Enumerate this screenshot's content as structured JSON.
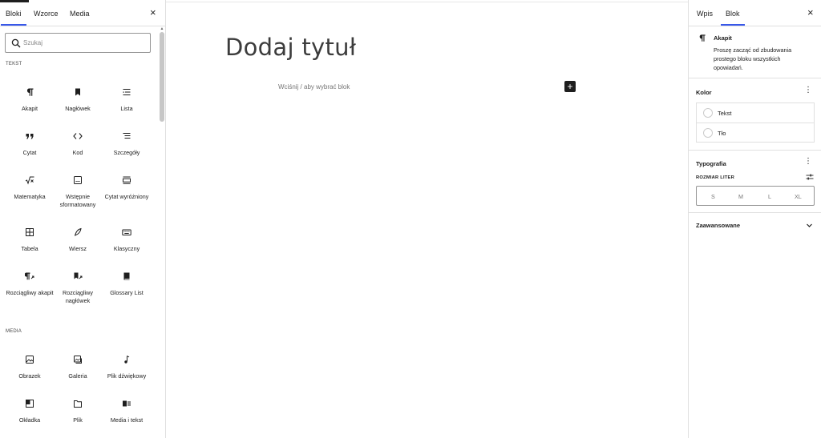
{
  "inserter": {
    "tabs": [
      {
        "label": "Bloki"
      },
      {
        "label": "Wzorce"
      },
      {
        "label": "Media"
      }
    ],
    "close": "×",
    "search": {
      "placeholder": "Szukaj",
      "value": ""
    },
    "sections": [
      {
        "label": "TEKST"
      },
      {
        "label": "MEDIA"
      }
    ],
    "blocks": [
      {
        "label": "Akapit",
        "icon": "paragraph-icon"
      },
      {
        "label": "Nagłówek",
        "icon": "heading-bookmark-icon"
      },
      {
        "label": "Lista",
        "icon": "list-icon"
      },
      {
        "label": "Cytat",
        "icon": "quote-icon"
      },
      {
        "label": "Kod",
        "icon": "code-icon"
      },
      {
        "label": "Szczegóły",
        "icon": "details-icon"
      },
      {
        "label": "Matematyka",
        "icon": "math-icon"
      },
      {
        "label": "Wstępnie sformatowany",
        "icon": "preformatted-icon"
      },
      {
        "label": "Cytat wyróżniony",
        "icon": "pullquote-icon"
      },
      {
        "label": "Tabela",
        "icon": "table-icon"
      },
      {
        "label": "Wiersz",
        "icon": "verse-feather-icon"
      },
      {
        "label": "Klasyczny",
        "icon": "keyboard-icon"
      },
      {
        "label": "Rozciągliwy akapit",
        "icon": "stretchy-paragraph-icon"
      },
      {
        "label": "Rozciągliwy nagłówek",
        "icon": "stretchy-heading-icon"
      },
      {
        "label": "Glossary List",
        "icon": "book-icon"
      },
      {
        "label": "Obrazek",
        "icon": "image-icon"
      },
      {
        "label": "Galeria",
        "icon": "gallery-icon"
      },
      {
        "label": "Plik dźwiękowy",
        "icon": "audio-note-icon"
      },
      {
        "label": "Okładka",
        "icon": "cover-icon"
      },
      {
        "label": "Plik",
        "icon": "folder-icon"
      },
      {
        "label": "Media i tekst",
        "icon": "media-text-icon"
      }
    ]
  },
  "editor": {
    "title_placeholder": "Dodaj tytuł",
    "block_placeholder": "Wciśnij / aby wybrać blok",
    "add_block": "+"
  },
  "settings": {
    "tabs": [
      {
        "label": "Wpis"
      },
      {
        "label": "Blok"
      }
    ],
    "close": "×",
    "block_card": {
      "title": "Akapit",
      "description": "Proszę zacząć od zbudowania prostego bloku wszystkich opowiadań."
    },
    "color": {
      "title": "Kolor",
      "items": [
        {
          "label": "Tekst"
        },
        {
          "label": "Tło"
        }
      ]
    },
    "typography": {
      "title": "Typografia",
      "size_label": "ROZMIAR LITER",
      "sizes": [
        "S",
        "M",
        "L",
        "XL"
      ]
    },
    "advanced": {
      "title": "Zaawansowane"
    },
    "colors": {
      "accent": "#3858e9",
      "dark": "#1e1e1e",
      "border": "#e0e0e0"
    }
  }
}
